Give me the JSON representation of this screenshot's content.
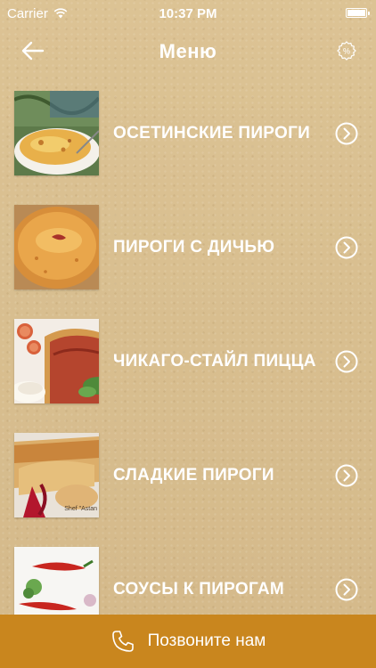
{
  "status_bar": {
    "carrier": "Carrier",
    "time": "10:37 PM"
  },
  "nav": {
    "title": "Меню",
    "back_icon": "arrow-left-icon",
    "right_icon": "percent-badge-icon"
  },
  "menu": {
    "items": [
      {
        "label": "ОСЕТИНСКИЕ ПИРОГИ",
        "image": "ossetian-pie-photo"
      },
      {
        "label": "ПИРОГИ С ДИЧЬЮ",
        "image": "game-pie-photo"
      },
      {
        "label": "ЧИКАГО-СТАЙЛ ПИЦЦА",
        "image": "chicago-pizza-photo"
      },
      {
        "label": "СЛАДКИЕ ПИРОГИ",
        "image": "sweet-pie-photo",
        "watermark": "Shef \"Astan"
      },
      {
        "label": "СОУСЫ К ПИРОГАМ",
        "image": "sauces-photo"
      }
    ]
  },
  "call_bar": {
    "label": "Позвоните нам",
    "icon": "phone-icon",
    "color": "#c9861e"
  }
}
